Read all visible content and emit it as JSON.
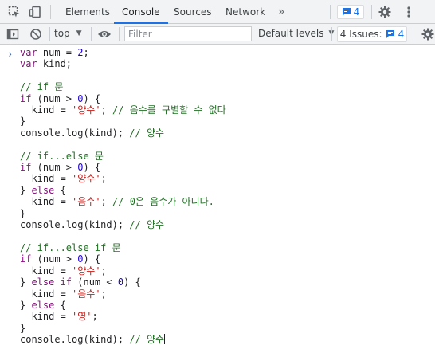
{
  "tabbar": {
    "tabs": [
      "Elements",
      "Console",
      "Sources",
      "Network"
    ],
    "active_tab": "Console",
    "more": "»",
    "issue_count": "4"
  },
  "toolbar": {
    "context": "top",
    "filter_placeholder": "Filter",
    "filter_value": "",
    "levels": "Default levels",
    "issues_label": "4 Issues:",
    "issues_count": "4"
  },
  "console": {
    "prompt": "›",
    "lines": [
      [
        [
          "kw",
          "var"
        ],
        [
          "p",
          " num = "
        ],
        [
          "num",
          "2"
        ],
        [
          "p",
          ";"
        ]
      ],
      [
        [
          "kw",
          "var"
        ],
        [
          "p",
          " kind;"
        ]
      ],
      [],
      [
        [
          "cm",
          "// if 문"
        ]
      ],
      [
        [
          "kw",
          "if"
        ],
        [
          "p",
          " (num > "
        ],
        [
          "num",
          "0"
        ],
        [
          "p",
          ") {"
        ]
      ],
      [
        [
          "p",
          "  kind = "
        ],
        [
          "str",
          "'양수'"
        ],
        [
          "p",
          "; "
        ],
        [
          "cm",
          "// 음수를 구별할 수 없다"
        ]
      ],
      [
        [
          "p",
          "}"
        ]
      ],
      [
        [
          "p",
          "console.log(kind); "
        ],
        [
          "cm",
          "// 양수"
        ]
      ],
      [],
      [
        [
          "cm",
          "// if...else 문"
        ]
      ],
      [
        [
          "kw",
          "if"
        ],
        [
          "p",
          " (num > "
        ],
        [
          "num",
          "0"
        ],
        [
          "p",
          ") {"
        ]
      ],
      [
        [
          "p",
          "  kind = "
        ],
        [
          "str",
          "'양수'"
        ],
        [
          "p",
          ";"
        ]
      ],
      [
        [
          "p",
          "} "
        ],
        [
          "kw",
          "else"
        ],
        [
          "p",
          " {"
        ]
      ],
      [
        [
          "p",
          "  kind = "
        ],
        [
          "str",
          "'음수'"
        ],
        [
          "p",
          "; "
        ],
        [
          "cm",
          "// 0은 음수가 아니다."
        ]
      ],
      [
        [
          "p",
          "}"
        ]
      ],
      [
        [
          "p",
          "console.log(kind); "
        ],
        [
          "cm",
          "// 양수"
        ]
      ],
      [],
      [
        [
          "cm",
          "// if...else if 문"
        ]
      ],
      [
        [
          "kw",
          "if"
        ],
        [
          "p",
          " (num > "
        ],
        [
          "num",
          "0"
        ],
        [
          "p",
          ") {"
        ]
      ],
      [
        [
          "p",
          "  kind = "
        ],
        [
          "str",
          "'양수'"
        ],
        [
          "p",
          ";"
        ]
      ],
      [
        [
          "p",
          "} "
        ],
        [
          "kw",
          "else if"
        ],
        [
          "p",
          " (num < "
        ],
        [
          "num",
          "0"
        ],
        [
          "p",
          ") {"
        ]
      ],
      [
        [
          "p",
          "  kind = "
        ],
        [
          "str",
          "'음수'"
        ],
        [
          "p",
          ";"
        ]
      ],
      [
        [
          "p",
          "} "
        ],
        [
          "kw",
          "else"
        ],
        [
          "p",
          " {"
        ]
      ],
      [
        [
          "p",
          "  kind = "
        ],
        [
          "str",
          "'영'"
        ],
        [
          "p",
          ";"
        ]
      ],
      [
        [
          "p",
          "}"
        ]
      ],
      [
        [
          "p",
          "console.log(kind); "
        ],
        [
          "cm",
          "// 양수"
        ]
      ]
    ]
  }
}
